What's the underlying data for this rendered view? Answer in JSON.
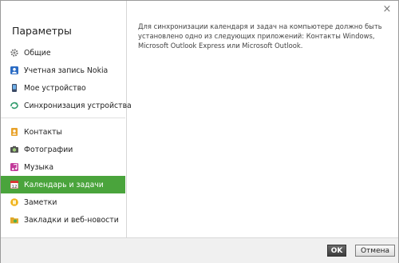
{
  "window": {
    "close_label": "×"
  },
  "sidebar": {
    "title": "Параметры",
    "items": [
      {
        "label": "Общие",
        "icon": "gear-icon"
      },
      {
        "label": "Учетная запись Nokia",
        "icon": "account-icon"
      },
      {
        "label": "Мое устройство",
        "icon": "phone-icon"
      },
      {
        "label": "Синхронизация устройства",
        "icon": "sync-icon"
      },
      {
        "label": "Контакты",
        "icon": "contacts-icon"
      },
      {
        "label": "Фотографии",
        "icon": "photos-icon"
      },
      {
        "label": "Музыка",
        "icon": "music-icon"
      },
      {
        "label": "Календарь и задачи",
        "icon": "calendar-icon",
        "selected": true
      },
      {
        "label": "Заметки",
        "icon": "notes-icon"
      },
      {
        "label": "Закладки и веб-новости",
        "icon": "bookmarks-icon"
      }
    ]
  },
  "content": {
    "text": "Для синхронизации календаря и задач на компьютере должно быть установлено одно из следующих приложений: Контакты Windows, Microsoft Outlook Express или Microsoft Outlook."
  },
  "footer": {
    "ok_label": "OK",
    "cancel_label": "Отмена"
  },
  "colors": {
    "selected_bg": "#4aa43c",
    "text": "#222222"
  }
}
